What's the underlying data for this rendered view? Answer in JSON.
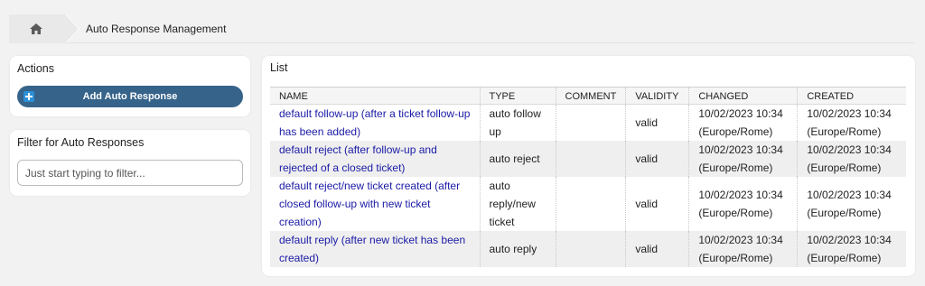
{
  "breadcrumb": {
    "home_icon": "home-icon",
    "title": "Auto Response Management"
  },
  "actions": {
    "heading": "Actions",
    "add_button_label": "Add Auto Response",
    "add_button_icon": "plus-square-icon"
  },
  "filter": {
    "heading": "Filter for Auto Responses",
    "placeholder": "Just start typing to filter...",
    "value": ""
  },
  "list": {
    "heading": "List",
    "columns": [
      "NAME",
      "TYPE",
      "COMMENT",
      "VALIDITY",
      "CHANGED",
      "CREATED"
    ],
    "rows": [
      {
        "name": "default follow-up (after a ticket follow-up has been added)",
        "type": "auto follow up",
        "comment": "",
        "validity": "valid",
        "changed": "10/02/2023 10:34 (Europe/Rome)",
        "created": "10/02/2023 10:34 (Europe/Rome)"
      },
      {
        "name": "default reject (after follow-up and rejected of a closed ticket)",
        "type": "auto reject",
        "comment": "",
        "validity": "valid",
        "changed": "10/02/2023 10:34 (Europe/Rome)",
        "created": "10/02/2023 10:34 (Europe/Rome)"
      },
      {
        "name": "default reject/new ticket created (after closed follow-up with new ticket creation)",
        "type": "auto reply/new ticket",
        "comment": "",
        "validity": "valid",
        "changed": "10/02/2023 10:34 (Europe/Rome)",
        "created": "10/02/2023 10:34 (Europe/Rome)"
      },
      {
        "name": "default reply (after new ticket has been created)",
        "type": "auto reply",
        "comment": "",
        "validity": "valid",
        "changed": "10/02/2023 10:34 (Europe/Rome)",
        "created": "10/02/2023 10:34 (Europe/Rome)"
      }
    ]
  },
  "colors": {
    "primary_button": "#36638a",
    "link": "#1a1aa6",
    "background": "#f2f2f2"
  }
}
